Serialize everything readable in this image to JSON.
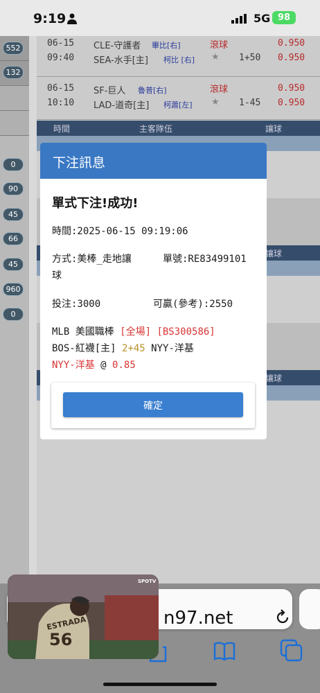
{
  "status_bar": {
    "time": "9:19",
    "network": "5G",
    "battery": "98"
  },
  "left_badges": [
    "552",
    "132",
    "0",
    "90",
    "45",
    "66",
    "45",
    "960",
    "0"
  ],
  "matches": [
    {
      "date": "06-15",
      "time": "09:40",
      "away": "CLE-守護者",
      "away_pitcher": "畢比[右]",
      "home": "SEA-水手[主]",
      "home_pitcher": "柯比 [右]",
      "live": "滾球",
      "line": "1+50",
      "odds_top": "0.950",
      "odds_bottom": "0.950"
    },
    {
      "date": "06-15",
      "time": "10:10",
      "away": "SF-巨人",
      "away_pitcher": "魯普[右]",
      "home": "LAD-道奇[主]",
      "home_pitcher": "柯蕭[左]",
      "live": "滾球",
      "line": "1-45",
      "odds_top": "0.950",
      "odds_bottom": "0.950"
    }
  ],
  "table_header": {
    "time": "時間",
    "teams": "主客隊伍",
    "handicap": "讓球"
  },
  "section_headers": [
    "讓球",
    "讓球"
  ],
  "modal": {
    "title": "下注訊息",
    "success": "單式下注!成功!",
    "time_label": "時間:2025-06-15 09:19:06",
    "method_label": "方式:美棒_走地讓",
    "method_wrap": "球",
    "ticket_label": "單號:RE83499101",
    "stake_label": "投注:3000",
    "win_label": "可贏(參考):2550",
    "league": "MLB 美國職棒",
    "scope": "[全場]",
    "bet_code": "[BS300586]",
    "home_team": "BOS-紅襪[主]",
    "line": "2+45",
    "away_team": "NYY-洋基",
    "pick": "NYY-洋基",
    "at": "@",
    "odds": "0.85",
    "confirm": "確定"
  },
  "browser": {
    "url": "n97.net"
  },
  "video": {
    "jersey_name": "ESTRADA",
    "jersey_number": "56",
    "channel": "SPOTV"
  },
  "colors": {
    "modal_header": "#3a78c4",
    "confirm_button": "#3a7fd0",
    "red": "#d93434",
    "gold": "#b8912a"
  }
}
